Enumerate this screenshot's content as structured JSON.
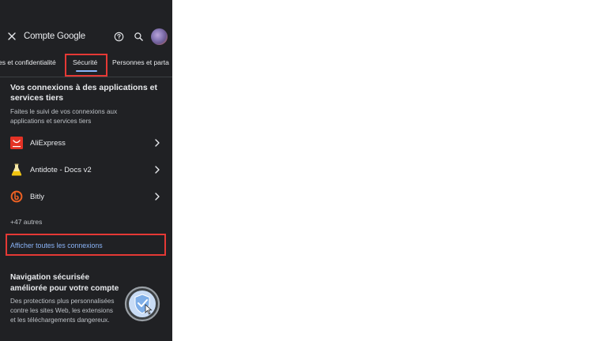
{
  "header": {
    "title": "Compte Google"
  },
  "tabs": [
    {
      "label": "es et confidentialité"
    },
    {
      "label": "Sécurité"
    },
    {
      "label": "Personnes et parta"
    }
  ],
  "section": {
    "title": "Vos connexions à des applications et services tiers",
    "description": "Faites le suivi de vos connexions aux applications et services tiers",
    "apps": [
      {
        "label": "AliExpress"
      },
      {
        "label": "Antidote - Docs v2"
      },
      {
        "label": "Bitly"
      }
    ],
    "more_count": "+47 autres",
    "show_all_label": "Afficher toutes les connexions"
  },
  "navigation": {
    "title": "Navigation sécurisée améliorée pour votre compte",
    "description": "Des protections plus personnalisées contre les sites Web, les extensions et les téléchargements dangereux."
  },
  "colors": {
    "panel_bg": "#202124",
    "accent": "#8ab4f8",
    "highlight": "#e53935"
  },
  "icons": {
    "close": "close-icon",
    "help": "help-icon",
    "search": "search-icon",
    "aliexpress": "aliexpress-icon",
    "antidote": "antidote-icon",
    "bitly": "bitly-icon",
    "chevron": "chevron-right-icon",
    "shield": "shield-icon"
  }
}
